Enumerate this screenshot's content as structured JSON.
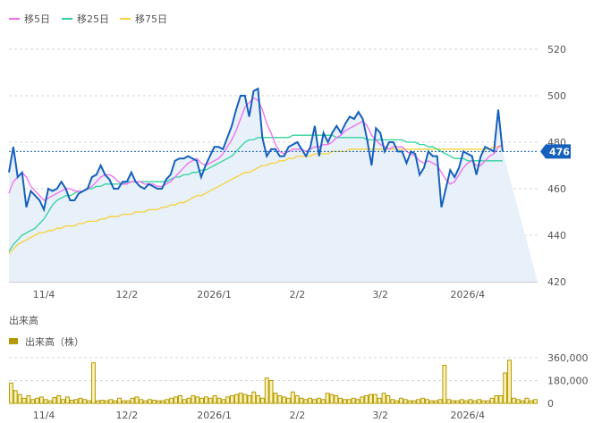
{
  "legend_price": [
    {
      "label": "移5日",
      "color": "#f06cf0"
    },
    {
      "label": "移25日",
      "color": "#2fd39a"
    },
    {
      "label": "移75日",
      "color": "#f5d23a"
    }
  ],
  "volume_title": "出来高",
  "volume_legend": {
    "label": "出来高（株）",
    "color": "#b39a00"
  },
  "current_price_badge": "476",
  "colors": {
    "price": "#1560bd",
    "price_fill": "#e8f0fa",
    "ma5": "#f06cf0",
    "ma25": "#2fd39a",
    "ma75": "#f5d23a",
    "volume_fill": "#faf1b8",
    "volume_stroke": "#b39a00",
    "badge": "#1560bd",
    "grid": "#d6d6d6"
  },
  "chart_data": [
    {
      "type": "line",
      "title": "",
      "xlabel": "",
      "ylabel": "",
      "ylim": [
        420,
        520
      ],
      "yticks": [
        420,
        440,
        460,
        480,
        500,
        520
      ],
      "x_tick_labels": [
        "11/4",
        "12/2",
        "2026/1",
        "2/2",
        "3/2",
        "2026/4"
      ],
      "x_tick_index": [
        8,
        27,
        47,
        66,
        85,
        105
      ],
      "n_points": 122,
      "current_price": 476,
      "series": [
        {
          "name": "price",
          "values": [
            467,
            478,
            465,
            467,
            452,
            459,
            457,
            455,
            451,
            460,
            459,
            460,
            463,
            460,
            455,
            455,
            458,
            459,
            460,
            465,
            466,
            470,
            466,
            464,
            460,
            460,
            463,
            463,
            467,
            463,
            461,
            460,
            462,
            461,
            460,
            460,
            464,
            466,
            472,
            473,
            473,
            474,
            473,
            472,
            465,
            470,
            474,
            478,
            478,
            477,
            482,
            487,
            494,
            500,
            500,
            491,
            502,
            503,
            482,
            474,
            477,
            477,
            474,
            474,
            478,
            479,
            480,
            477,
            474,
            478,
            487,
            474,
            484,
            480,
            484,
            487,
            484,
            488,
            491,
            490,
            493,
            490,
            481,
            470,
            486,
            484,
            476,
            480,
            480,
            476,
            476,
            471,
            476,
            475,
            466,
            469,
            476,
            474,
            474,
            452,
            460,
            468,
            465,
            469,
            476,
            475,
            474,
            466,
            474,
            478,
            477,
            476,
            494,
            476
          ]
        },
        {
          "name": "移5日",
          "values": [
            458,
            463,
            465,
            467,
            465,
            461,
            459,
            457,
            455,
            456,
            457,
            458,
            459,
            460,
            460,
            459,
            459,
            459,
            460,
            461,
            463,
            465,
            466,
            466,
            465,
            463,
            462,
            462,
            463,
            463,
            463,
            462,
            462,
            462,
            461,
            461,
            462,
            463,
            465,
            467,
            469,
            471,
            472,
            473,
            471,
            470,
            471,
            472,
            473,
            475,
            478,
            481,
            485,
            490,
            495,
            497,
            499,
            498,
            494,
            488,
            484,
            479,
            476,
            475,
            476,
            477,
            477,
            477,
            476,
            477,
            478,
            478,
            479,
            479,
            480,
            482,
            483,
            485,
            486,
            487,
            488,
            489,
            487,
            483,
            481,
            479,
            478,
            477,
            478,
            478,
            478,
            476,
            475,
            474,
            472,
            471,
            472,
            471,
            470,
            467,
            464,
            462,
            463,
            466,
            469,
            471,
            472,
            470,
            470,
            472,
            474,
            475,
            478,
            479
          ]
        },
        {
          "name": "移25日",
          "values": [
            433,
            436,
            438,
            440,
            441,
            442,
            443,
            445,
            447,
            450,
            453,
            455,
            456,
            457,
            457,
            458,
            459,
            459,
            460,
            460,
            461,
            461,
            462,
            462,
            462,
            462,
            462,
            463,
            463,
            463,
            463,
            463,
            463,
            463,
            463,
            463,
            463,
            464,
            465,
            465,
            466,
            466,
            467,
            467,
            468,
            468,
            469,
            470,
            471,
            472,
            473,
            474,
            476,
            478,
            480,
            481,
            481,
            482,
            482,
            482,
            482,
            482,
            482,
            482,
            482,
            483,
            483,
            483,
            483,
            483,
            483,
            483,
            483,
            483,
            483,
            482,
            482,
            482,
            482,
            482,
            482,
            482,
            481,
            481,
            481,
            481,
            481,
            481,
            481,
            481,
            481,
            480,
            480,
            480,
            479,
            479,
            478,
            478,
            477,
            476,
            475,
            474,
            473,
            473,
            473,
            472,
            472,
            472,
            472,
            472,
            472,
            472,
            472,
            472
          ]
        },
        {
          "name": "移75日",
          "values": [
            432,
            434,
            436,
            437,
            438,
            439,
            440,
            441,
            441,
            442,
            442,
            443,
            443,
            444,
            444,
            444,
            445,
            445,
            446,
            446,
            446,
            447,
            447,
            448,
            448,
            448,
            449,
            449,
            449,
            450,
            450,
            450,
            451,
            451,
            451,
            452,
            452,
            453,
            453,
            454,
            454,
            455,
            456,
            457,
            457,
            458,
            459,
            460,
            461,
            462,
            463,
            464,
            465,
            466,
            467,
            467,
            468,
            469,
            470,
            470,
            471,
            471,
            472,
            472,
            473,
            473,
            474,
            474,
            474,
            474,
            475,
            475,
            475,
            475,
            476,
            476,
            476,
            476,
            477,
            477,
            477,
            477,
            477,
            477,
            477,
            477,
            477,
            477,
            477,
            477,
            477,
            477,
            477,
            477,
            477,
            477,
            477,
            477,
            477,
            477,
            477,
            477,
            477,
            477,
            477,
            477,
            477,
            477,
            477,
            477,
            477,
            478,
            478,
            478
          ]
        }
      ]
    },
    {
      "type": "bar",
      "title": "出来高",
      "xlabel": "",
      "ylabel": "",
      "ylim": [
        0,
        360000
      ],
      "yticks": [
        0,
        180000,
        360000
      ],
      "ytick_labels": [
        "0",
        "180,000",
        "360,000"
      ],
      "x_tick_labels": [
        "11/4",
        "12/2",
        "2026/1",
        "2/2",
        "3/2",
        "2026/4"
      ],
      "x_tick_index": [
        8,
        27,
        47,
        66,
        85,
        105
      ],
      "series": [
        {
          "name": "出来高",
          "values": [
            160000,
            100000,
            70000,
            40000,
            60000,
            30000,
            40000,
            50000,
            30000,
            20000,
            45000,
            60000,
            30000,
            50000,
            25000,
            30000,
            40000,
            30000,
            20000,
            320000,
            20000,
            25000,
            20000,
            30000,
            20000,
            40000,
            20000,
            20000,
            40000,
            50000,
            30000,
            20000,
            30000,
            25000,
            20000,
            20000,
            30000,
            40000,
            50000,
            60000,
            30000,
            40000,
            60000,
            50000,
            40000,
            50000,
            40000,
            60000,
            40000,
            30000,
            50000,
            60000,
            70000,
            80000,
            70000,
            60000,
            90000,
            60000,
            40000,
            200000,
            180000,
            80000,
            60000,
            50000,
            40000,
            90000,
            60000,
            40000,
            30000,
            40000,
            30000,
            40000,
            30000,
            80000,
            70000,
            60000,
            40000,
            30000,
            30000,
            40000,
            30000,
            50000,
            60000,
            70000,
            70000,
            40000,
            80000,
            60000,
            30000,
            20000,
            40000,
            30000,
            20000,
            20000,
            30000,
            40000,
            30000,
            20000,
            20000,
            30000,
            300000,
            30000,
            20000,
            20000,
            30000,
            20000,
            30000,
            20000,
            30000,
            20000,
            20000,
            40000,
            60000,
            60000,
            240000,
            340000,
            40000,
            30000,
            20000,
            40000,
            20000,
            30000
          ]
        }
      ]
    }
  ]
}
